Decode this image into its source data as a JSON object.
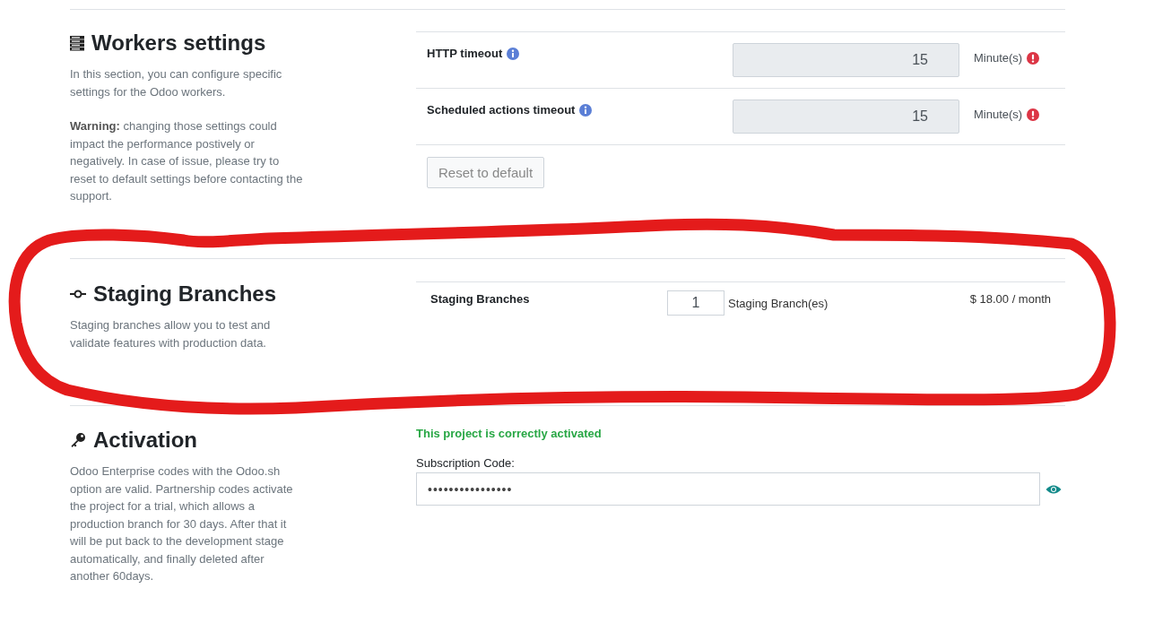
{
  "sections": [
    {
      "kind": "workers",
      "title": "Workers settings",
      "paragraphs": [
        "In this section, you can configure specific settings for the Odoo workers.",
        "**Warning:** changing those settings could impact the performance postively or negatively. In case of issue, please try to reset to default settings before contacting the support."
      ],
      "fields": [
        {
          "label": "HTTP timeout",
          "value": "15",
          "unit": "Minute(s)",
          "disabled": true,
          "warning": true
        },
        {
          "label": "Scheduled actions timeout",
          "value": "15",
          "unit": "Minute(s)",
          "disabled": true,
          "warning": true
        }
      ],
      "reset_button": {
        "label": "Reset to default",
        "disabled": true
      }
    },
    {
      "kind": "staging",
      "title": "Staging Branches",
      "paragraphs": [
        "Staging branches allow you to test and validate features with production data."
      ],
      "row": {
        "label": "Staging Branches",
        "value": "1",
        "unit": "Staging Branch(es)",
        "price": "$ 18.00 / month"
      }
    },
    {
      "kind": "activation",
      "title": "Activation",
      "paragraphs": [
        "Odoo Enterprise codes with the Odoo.sh option are valid. Partnership codes activate the project for a trial, which allows a production branch for 30 days. After that it will be put back to the development stage automatically, and finally deleted after another 60days."
      ],
      "status": "This project is correctly activated",
      "code_label": "Subscription Code:",
      "code_value": "••••••••••••••••"
    }
  ]
}
